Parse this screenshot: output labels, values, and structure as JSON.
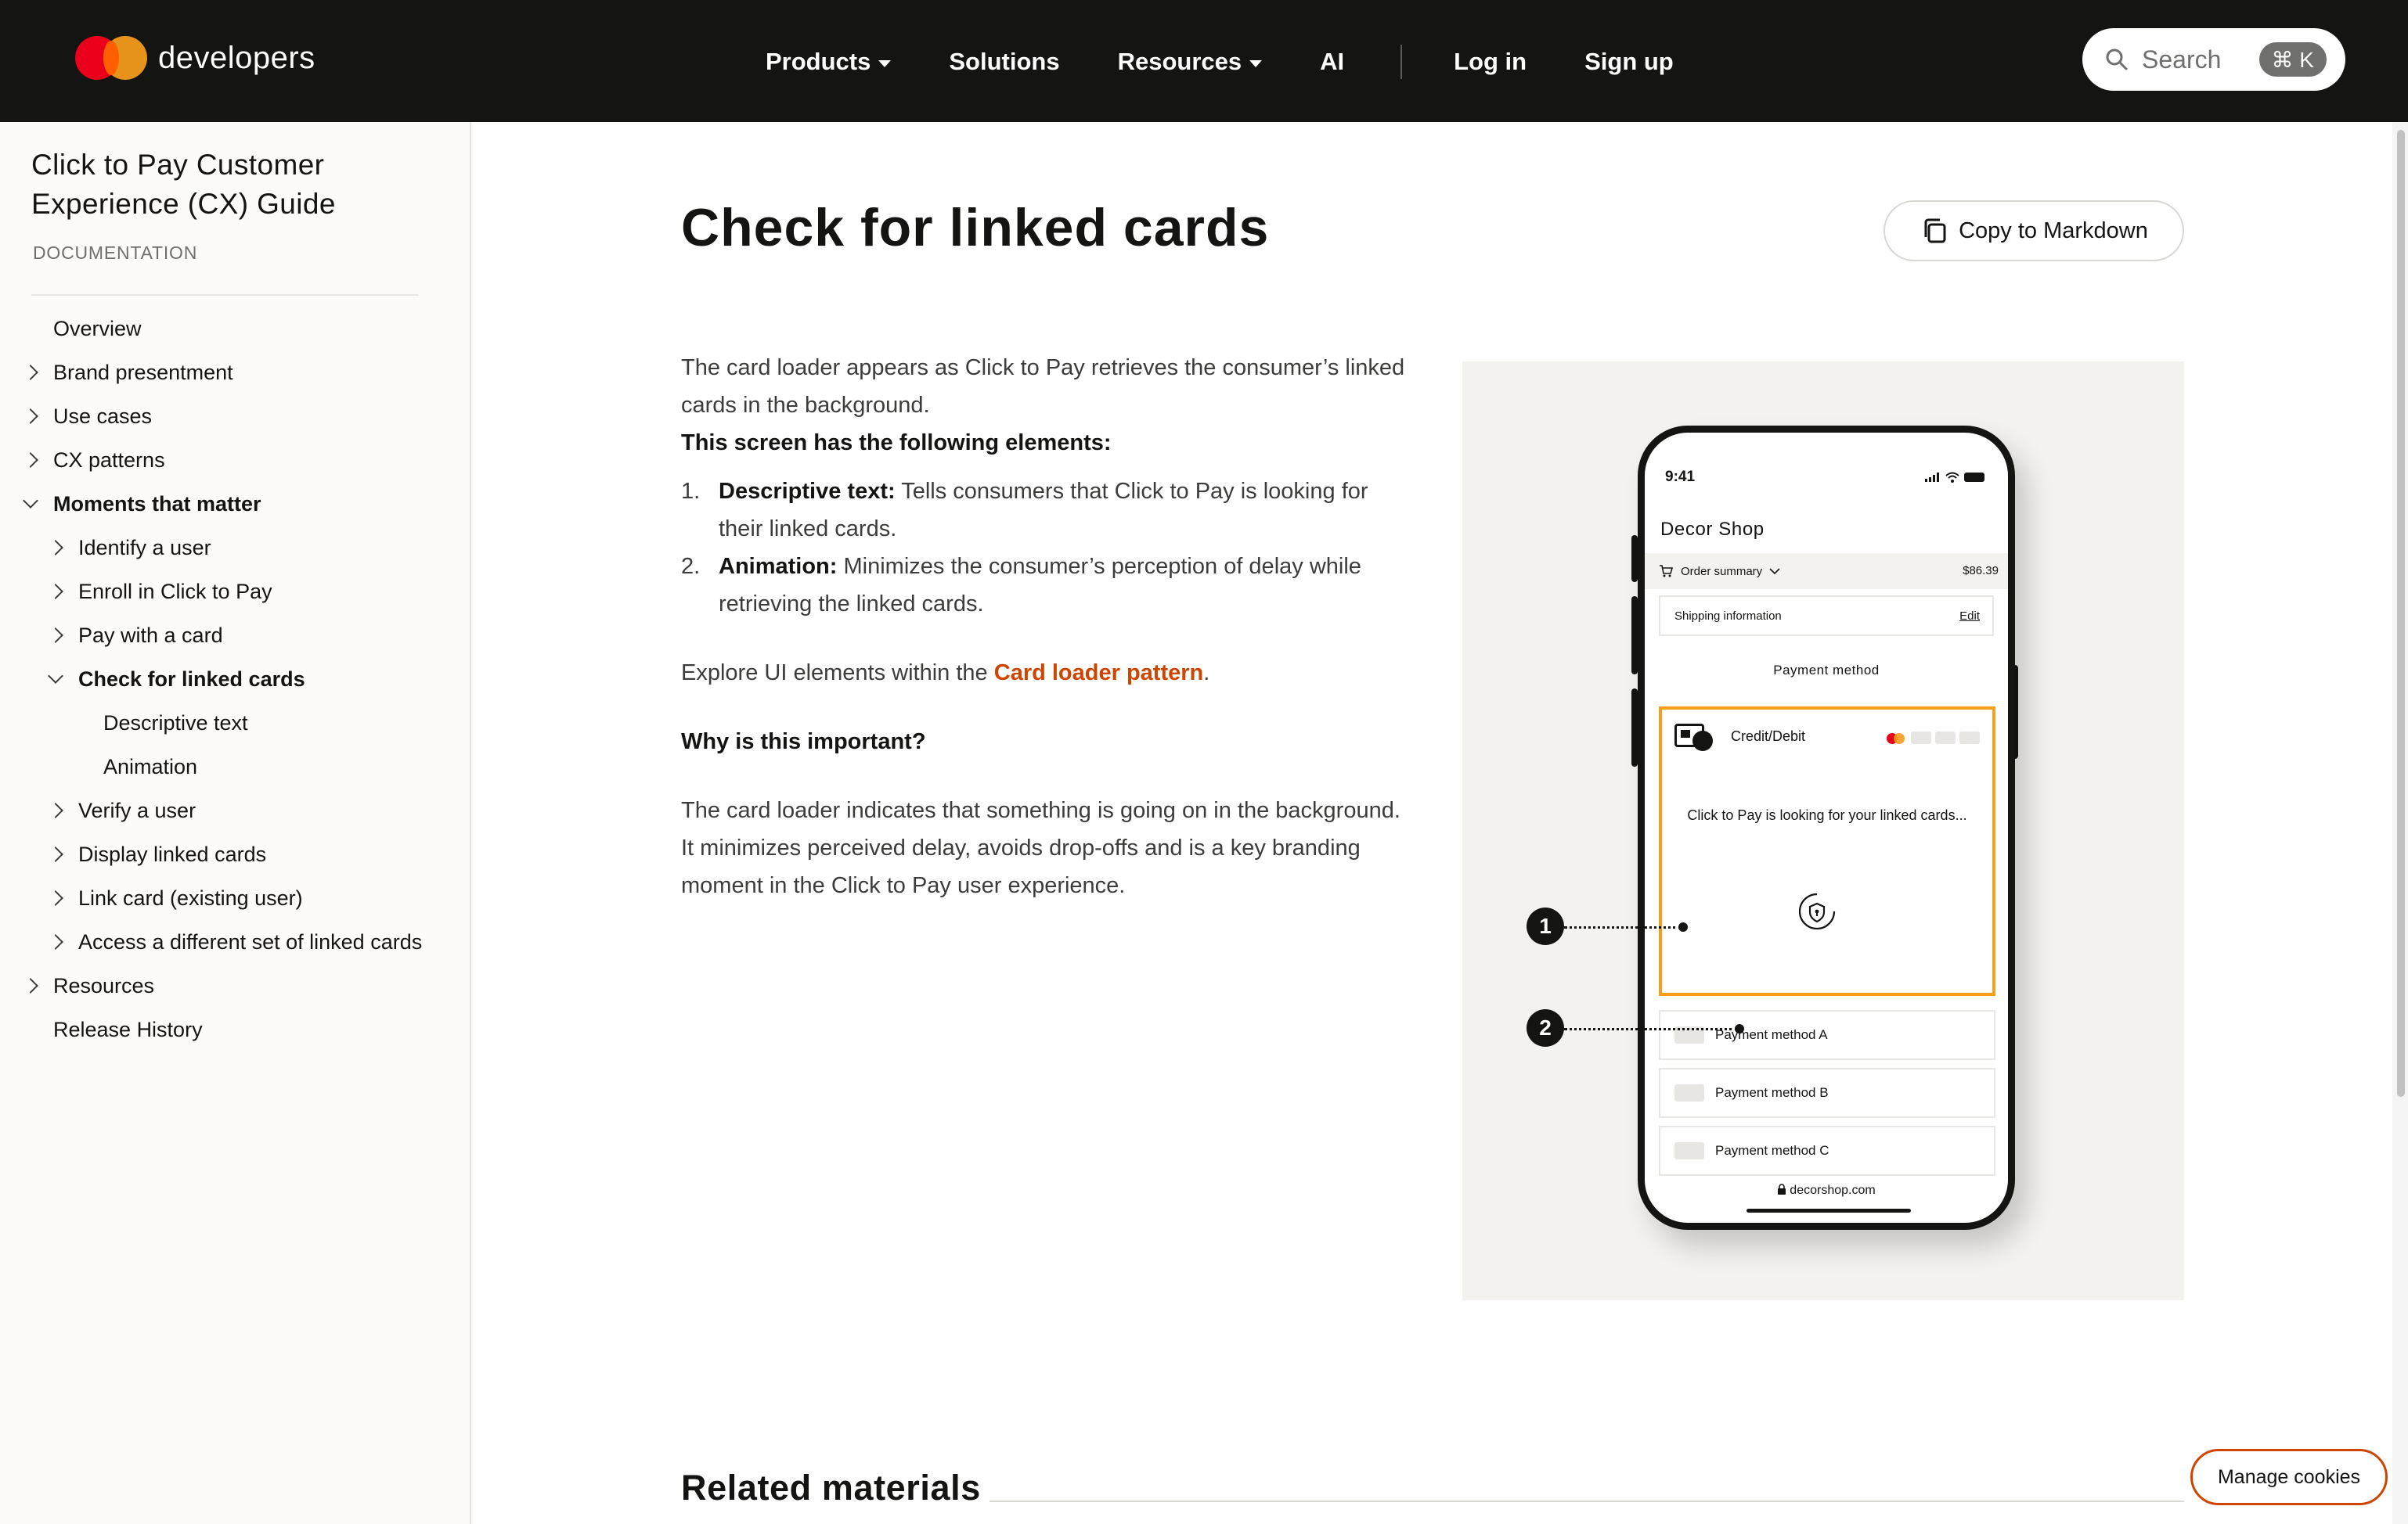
{
  "colors": {
    "nav_bg": "#141413",
    "accent_orange": "#cf4500",
    "loader_border": "#f79e1b",
    "mc_red": "#eb001b",
    "mc_yellow": "#f79e1b"
  },
  "header": {
    "brand": "developers",
    "nav": [
      {
        "label": "Products",
        "has_caret": true
      },
      {
        "label": "Solutions",
        "has_caret": false
      },
      {
        "label": "Resources",
        "has_caret": true
      },
      {
        "label": "AI",
        "has_caret": false
      },
      {
        "label": "Log in",
        "has_caret": false
      },
      {
        "label": "Sign up",
        "has_caret": false
      }
    ],
    "search": {
      "label": "Search",
      "shortcut": "⌘ K",
      "icon": "search-icon"
    }
  },
  "sidebar": {
    "title": "Click to Pay Customer Experience (CX) Guide",
    "subtitle": "DOCUMENTATION",
    "items": [
      {
        "label": "Overview",
        "level": 0,
        "chevron": "none",
        "bold": false
      },
      {
        "label": "Brand presentment",
        "level": 0,
        "chevron": "right",
        "bold": false
      },
      {
        "label": "Use cases",
        "level": 0,
        "chevron": "right",
        "bold": false
      },
      {
        "label": "CX patterns",
        "level": 0,
        "chevron": "right",
        "bold": false
      },
      {
        "label": "Moments that matter",
        "level": 0,
        "chevron": "down",
        "bold": true
      },
      {
        "label": "Identify a user",
        "level": 1,
        "chevron": "right",
        "bold": false
      },
      {
        "label": "Enroll in Click to Pay",
        "level": 1,
        "chevron": "right",
        "bold": false
      },
      {
        "label": "Pay with a card",
        "level": 1,
        "chevron": "right",
        "bold": false
      },
      {
        "label": "Check for linked cards",
        "level": 1,
        "chevron": "down",
        "bold": true
      },
      {
        "label": "Descriptive text",
        "level": 2,
        "chevron": "none",
        "bold": false
      },
      {
        "label": "Animation",
        "level": 2,
        "chevron": "none",
        "bold": false
      },
      {
        "label": "Verify a user",
        "level": 1,
        "chevron": "right",
        "bold": false
      },
      {
        "label": "Display linked cards",
        "level": 1,
        "chevron": "right",
        "bold": false
      },
      {
        "label": "Link card (existing user)",
        "level": 1,
        "chevron": "right",
        "bold": false
      },
      {
        "label": "Access a different set of linked cards",
        "level": 1,
        "chevron": "right",
        "bold": false
      },
      {
        "label": "Resources",
        "level": 0,
        "chevron": "right",
        "bold": false
      },
      {
        "label": "Release History",
        "level": 0,
        "chevron": "none",
        "bold": false
      }
    ]
  },
  "main": {
    "title": "Check for linked cards",
    "copy_button": "Copy to Markdown",
    "intro": "The card loader appears as Click to Pay retrieves the consumer’s linked cards in the background.",
    "elements_heading": "This screen has the following elements:",
    "elements": [
      {
        "num": "1.",
        "term": "Descriptive text:",
        "text": " Tells consumers that Click to Pay is looking for their linked cards."
      },
      {
        "num": "2.",
        "term": "Animation:",
        "text": " Minimizes the consumer’s perception of delay while retrieving the linked cards."
      }
    ],
    "explore_prefix": "Explore UI elements within the ",
    "explore_link": "Card loader pattern",
    "explore_suffix": ".",
    "why_heading": "Why is this important?",
    "why_text": "The card loader indicates that something is going on in the background. It minimizes perceived delay, avoids drop-offs and is a key branding moment in the Click to Pay user experience.",
    "related": "Related materials"
  },
  "figure": {
    "time": "9:41",
    "shop": "Decor Shop",
    "order_summary": "Order summary",
    "amount": "$86.39",
    "shipping": "Shipping information",
    "edit": "Edit",
    "payment_method": "Payment method",
    "credit_debit": "Credit/Debit",
    "loading_text": "Click to Pay is looking for your linked cards...",
    "methods": [
      "Payment method A",
      "Payment method B",
      "Payment method C"
    ],
    "url": "decorshop.com",
    "callouts": [
      "1",
      "2"
    ]
  },
  "cookies": {
    "label": "Manage cookies"
  }
}
